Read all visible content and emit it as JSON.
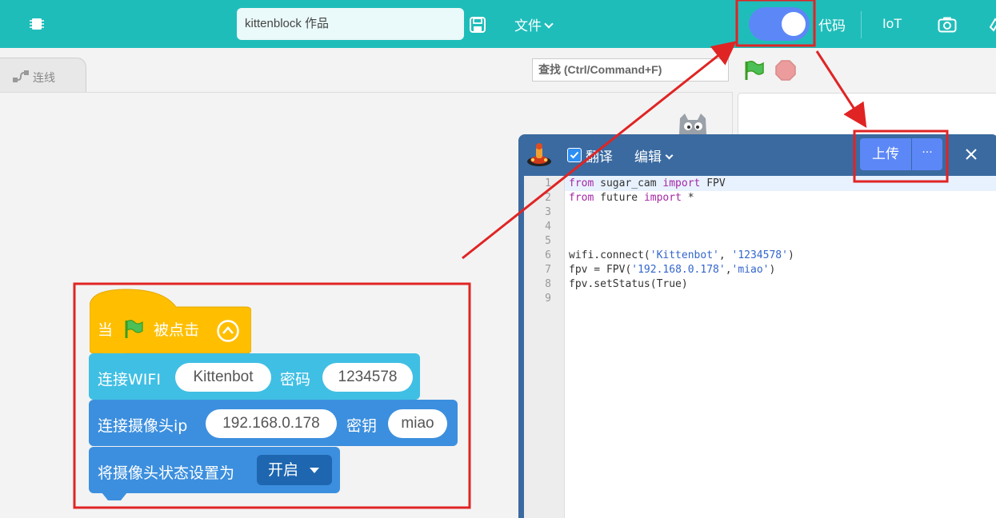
{
  "topbar": {
    "project_name": "kittenblock 作品",
    "file_menu_label": "文件",
    "code_label": "代码",
    "iot_label": "IoT",
    "icons": [
      "chip-icon",
      "save-icon",
      "camera-icon"
    ]
  },
  "workspace": {
    "wire_tab_label": "连线",
    "find_placeholder": "查找 (Ctrl/Command+F)"
  },
  "code_panel": {
    "translate_label": "翻译",
    "edit_menu_label": "编辑",
    "upload_label": "上传",
    "more_label": "···",
    "line_numbers": [
      "1",
      "2",
      "3",
      "4",
      "5",
      "6",
      "7",
      "8",
      "9"
    ],
    "lines": [
      "from sugar_cam import FPV",
      "from future import *",
      "",
      "",
      "",
      "wifi.connect('Kittenbot', '1234578')",
      "fpv = FPV('192.168.0.178','miao')",
      "fpv.setStatus(True)",
      ""
    ]
  },
  "blocks": {
    "hat": {
      "when": "当",
      "clicked": "被点击"
    },
    "wifi": {
      "label": "连接WIFI",
      "ssid": "Kittenbot",
      "pwd_label": "密码",
      "pwd": "1234578"
    },
    "camera": {
      "label": "连接摄像头ip",
      "ip": "192.168.0.178",
      "key_label": "密钥",
      "key": "miao"
    },
    "status": {
      "label": "将摄像头状态设置为",
      "value": "开启"
    }
  },
  "colors": {
    "topbar": "#1fbdba",
    "accent": "#5c87f7",
    "hat_block": "#ffbf00",
    "wifi_block": "#40bfe4",
    "camera_block": "#3c8fde",
    "annotation": "#e02424"
  }
}
